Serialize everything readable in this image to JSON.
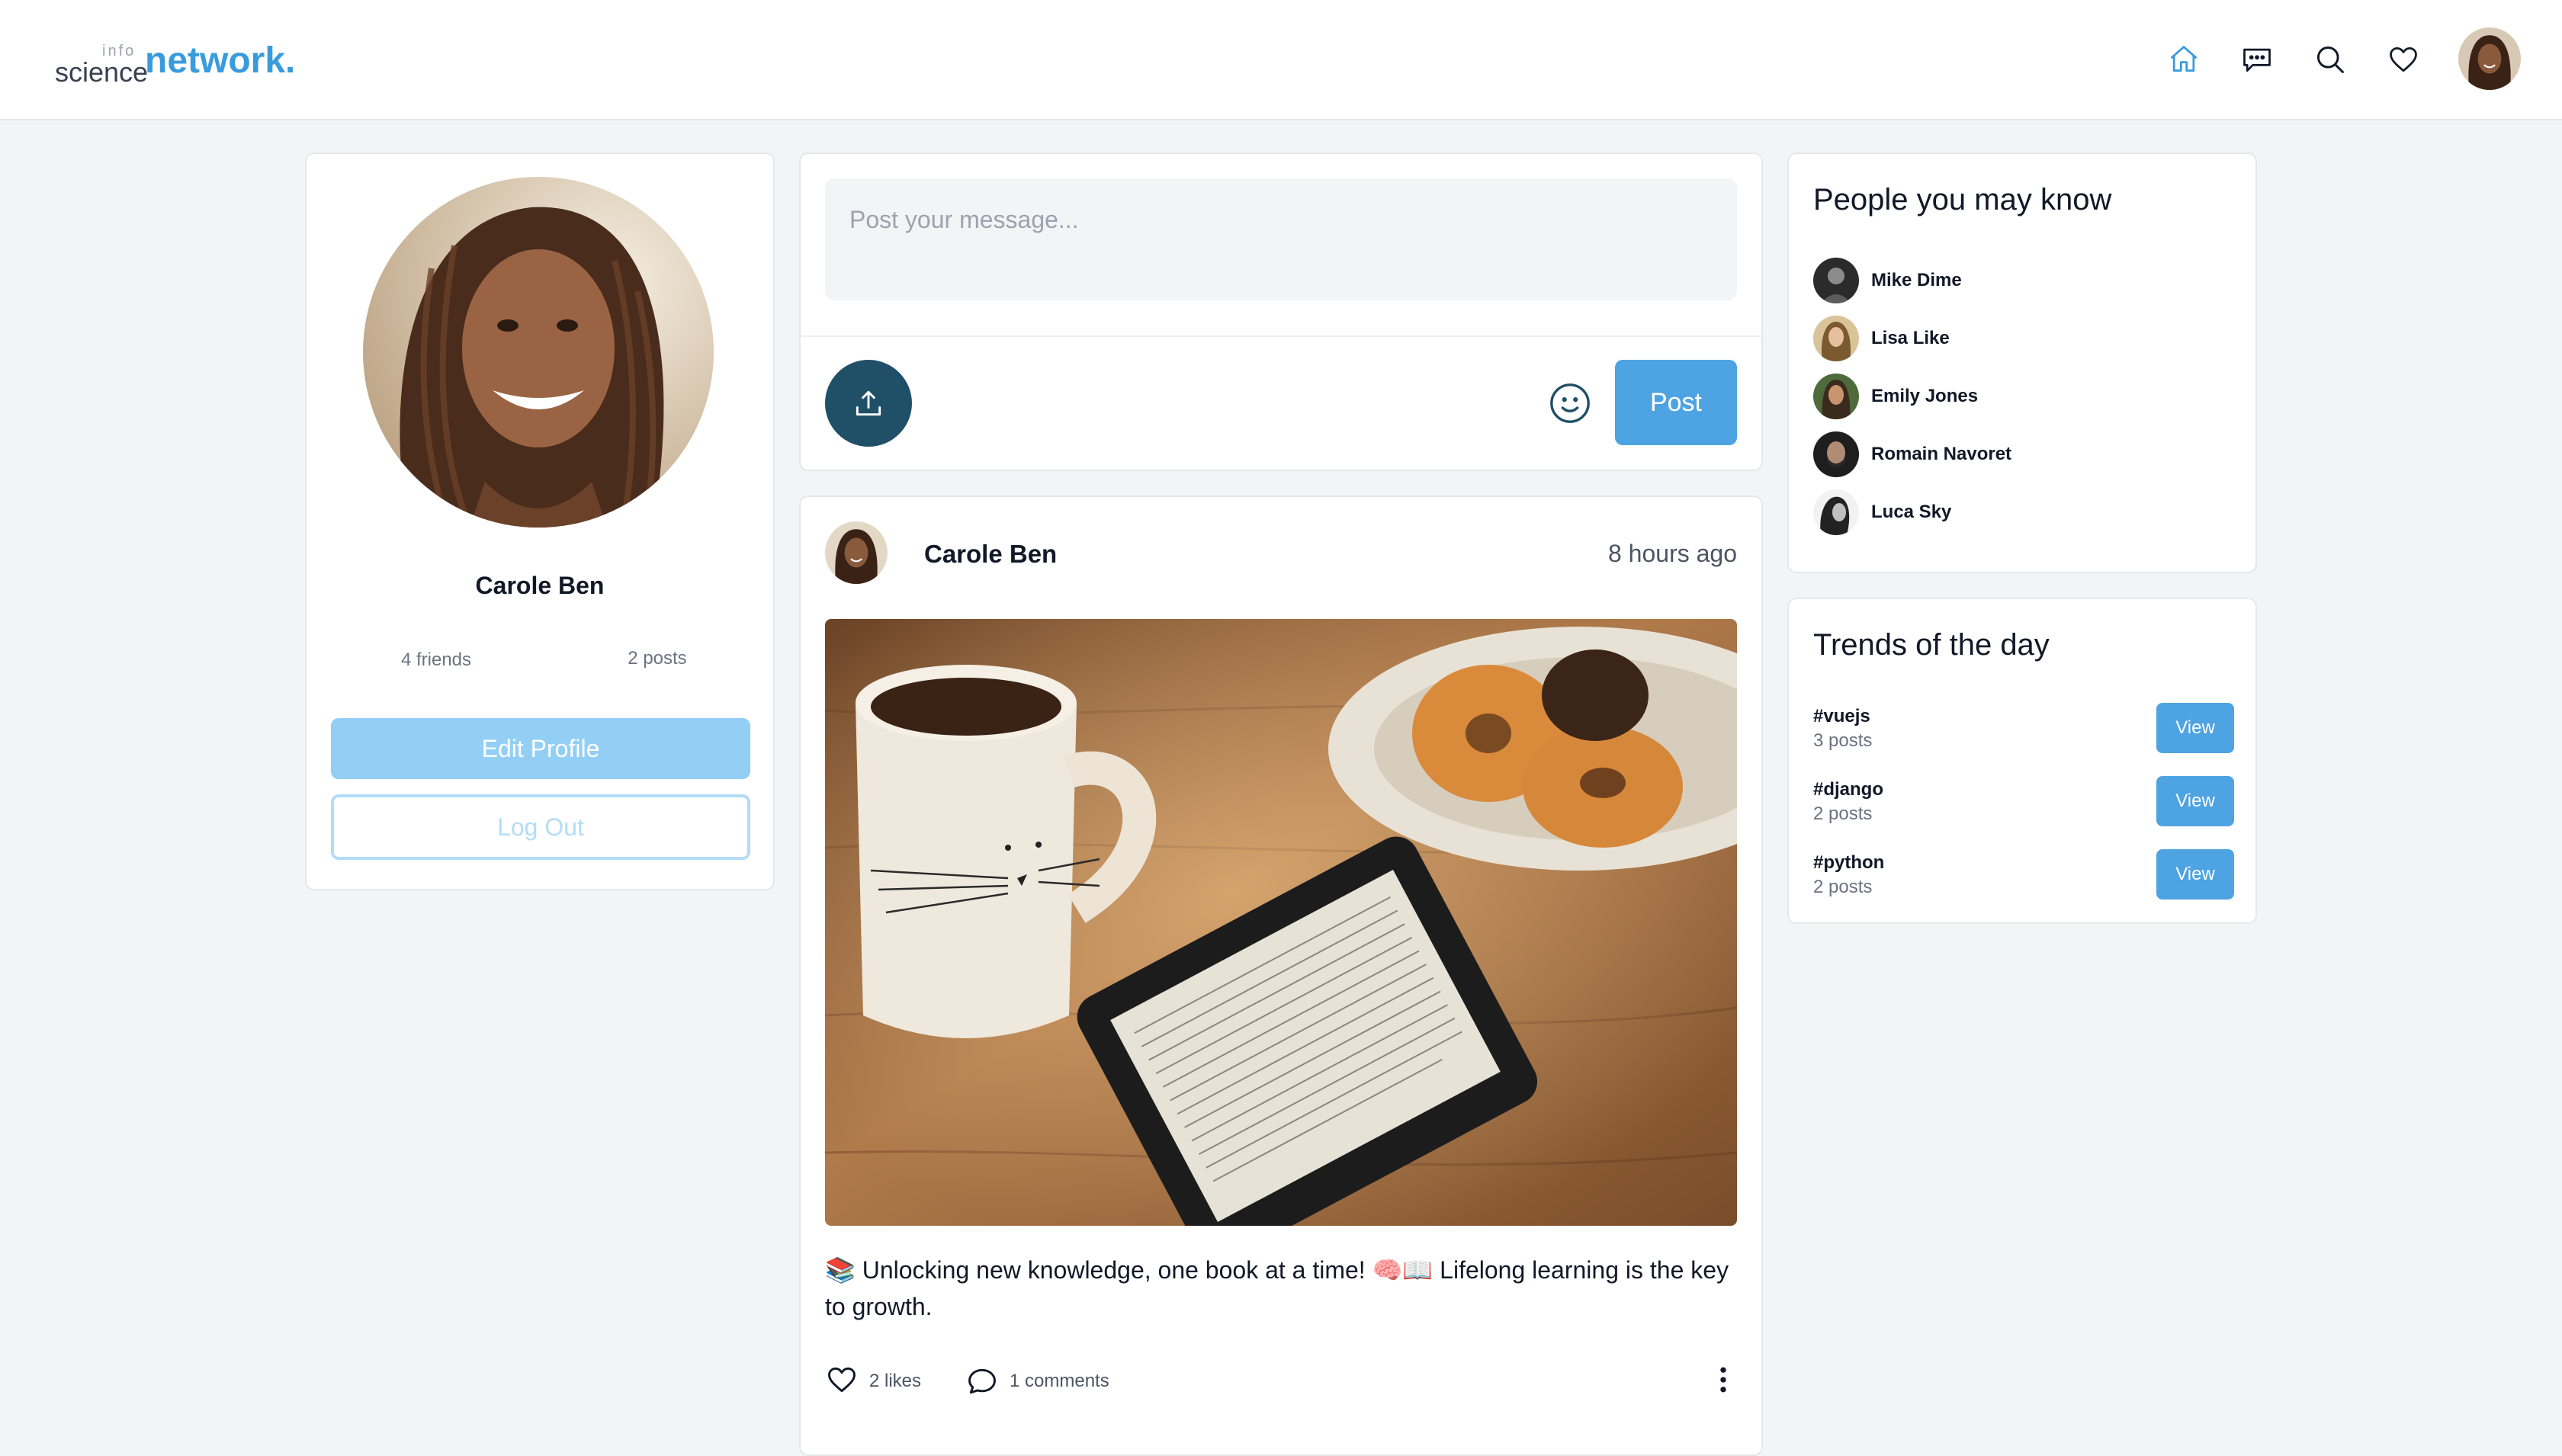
{
  "header": {
    "logo_small": "info",
    "logo_science": "science",
    "logo_network": "network.",
    "nav_icons": [
      "home-icon",
      "chat-icon",
      "search-icon",
      "heart-icon"
    ],
    "active_color": "#3a9bdc"
  },
  "profile": {
    "name": "Carole Ben",
    "friends": "4 friends",
    "posts": "2 posts",
    "edit_label": "Edit Profile",
    "logout_label": "Log Out"
  },
  "composer": {
    "placeholder": "Post your message...",
    "post_label": "Post"
  },
  "post": {
    "author": "Carole Ben",
    "time": "8 hours ago",
    "text": "📚 Unlocking new knowledge, one book at a time! 🧠📖 Lifelong learning is the key to growth.",
    "likes": "2 likes",
    "comments": "1 comments"
  },
  "people": {
    "title": "People you may know",
    "items": [
      {
        "name": "Mike Dime"
      },
      {
        "name": "Lisa Like"
      },
      {
        "name": "Emily Jones"
      },
      {
        "name": "Romain Navoret"
      },
      {
        "name": "Luca Sky"
      }
    ]
  },
  "trends": {
    "title": "Trends of the day",
    "items": [
      {
        "tag": "#vuejs",
        "count": "3 posts",
        "view_label": "View"
      },
      {
        "tag": "#django",
        "count": "2 posts",
        "view_label": "View"
      },
      {
        "tag": "#python",
        "count": "2 posts",
        "view_label": "View"
      }
    ]
  },
  "colors": {
    "accent": "#4ea3e2",
    "upload": "#204f68",
    "edit_button": "#93cff5"
  }
}
